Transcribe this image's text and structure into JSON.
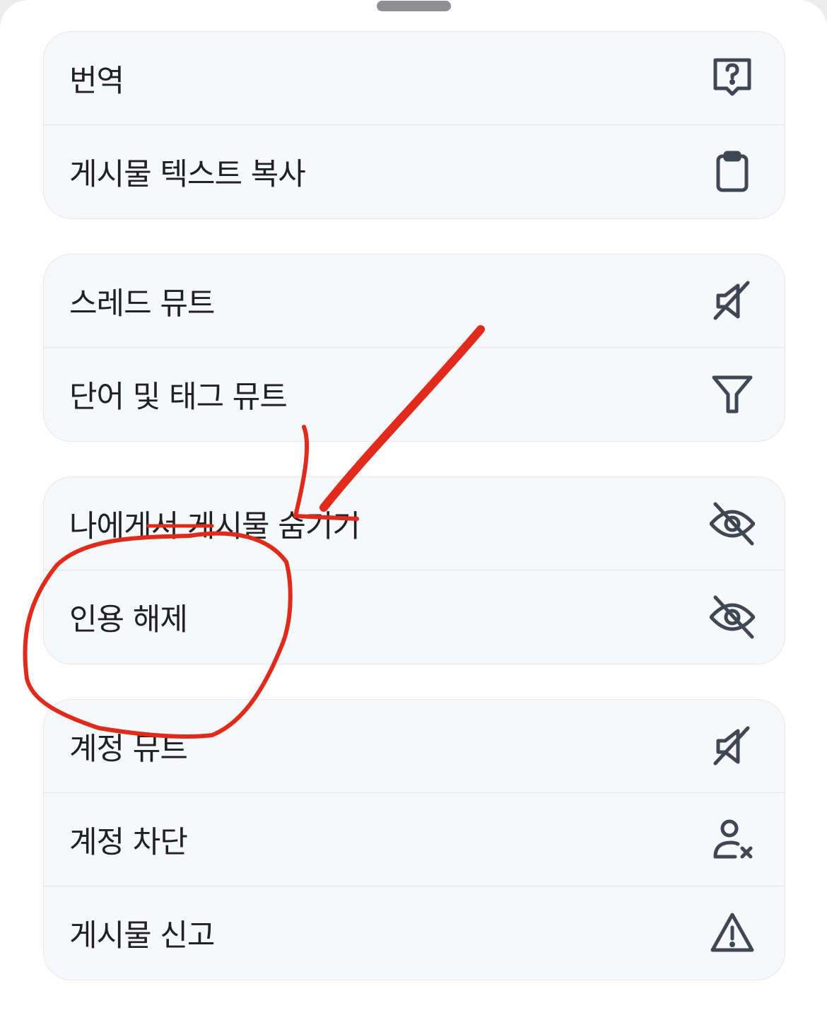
{
  "groups": [
    {
      "items": [
        {
          "label": "번역",
          "icon": "translate-question-icon"
        },
        {
          "label": "게시물 텍스트 복사",
          "icon": "clipboard-icon"
        }
      ]
    },
    {
      "items": [
        {
          "label": "스레드 뮤트",
          "icon": "mute-speaker-icon"
        },
        {
          "label": "단어 및 태그 뮤트",
          "icon": "filter-icon"
        }
      ]
    },
    {
      "items": [
        {
          "label": "나에게서 게시물 숨기기",
          "icon": "eye-off-icon"
        },
        {
          "label": "인용 해제",
          "icon": "eye-off-icon"
        }
      ]
    },
    {
      "items": [
        {
          "label": "계정 뮤트",
          "icon": "mute-speaker-icon"
        },
        {
          "label": "계정 차단",
          "icon": "user-block-icon"
        },
        {
          "label": "게시물 신고",
          "icon": "warning-icon"
        }
      ]
    }
  ],
  "colors": {
    "icon": "#3f4654",
    "annotation": "#e02a1b",
    "background": "#f7f8fa"
  }
}
